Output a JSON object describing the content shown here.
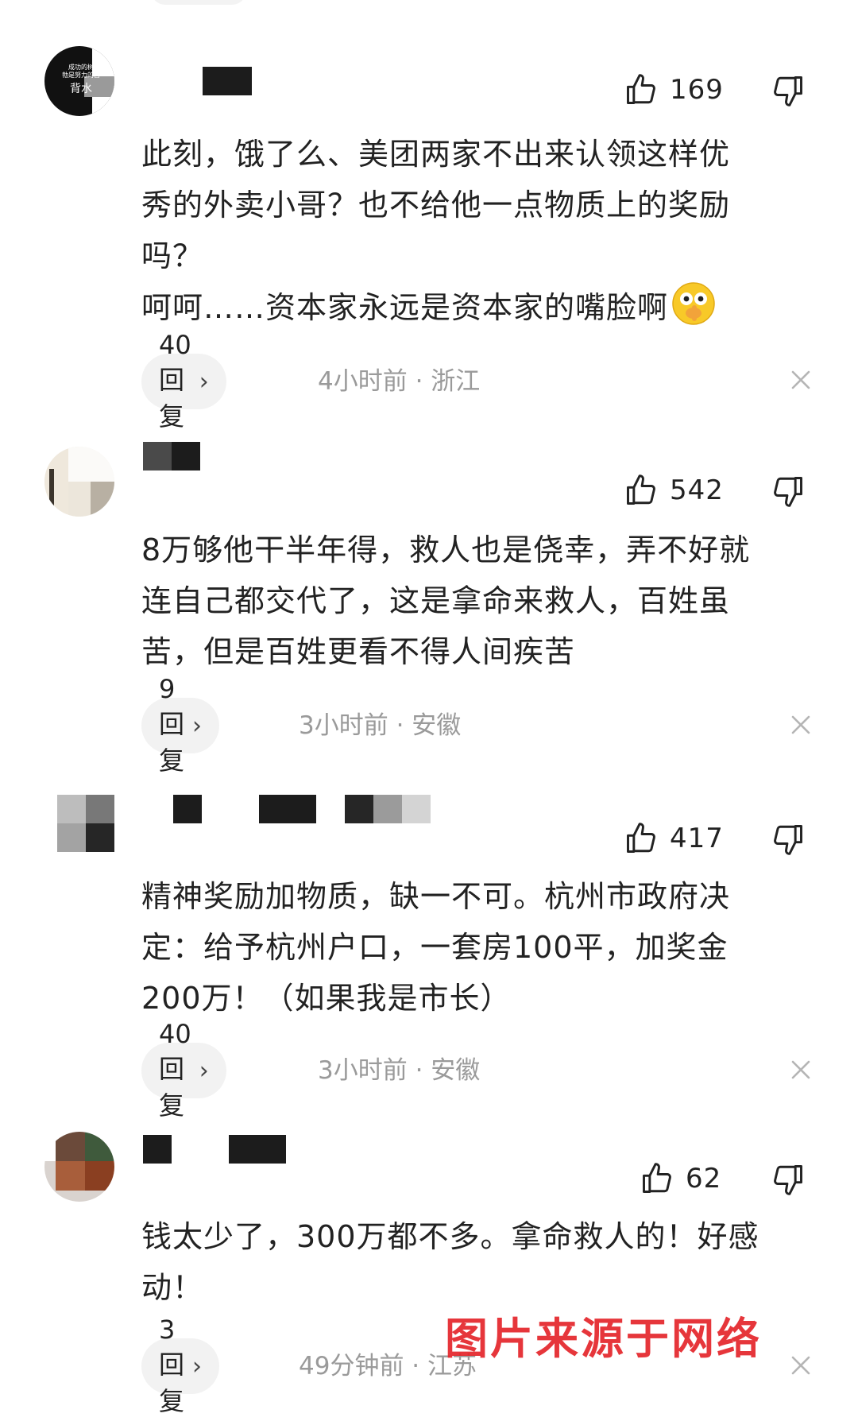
{
  "comments": [
    {
      "avatar_text": [
        "成功的树",
        "勃是努力的自",
        "背水"
      ],
      "likes": "169",
      "text": "此刻，饿了么、美团两家不出来认领这样优\n秀的外卖小哥？也不给他一点物质上的奖励\n吗？\n呵呵……资本家永远是资本家的嘴脸啊",
      "reply_label": "40回复",
      "meta": "4小时前 · 浙江",
      "emoji_icon": "hush-emoji-icon"
    },
    {
      "likes": "542",
      "text": "8万够他干半年得，救人也是侥幸，弄不好就\n连自己都交代了，这是拿命来救人，百姓虽\n苦，但是百姓更看不得人间疾苦",
      "reply_label": "9回复",
      "meta": "3小时前 · 安徽"
    },
    {
      "likes": "417",
      "text": "精神奖励加物质，缺一不可。杭州市政府决\n定：给予杭州户口，一套房100平，加奖金\n200万！（如果我是市长）",
      "reply_label": "40回复",
      "meta": "3小时前 · 安徽"
    },
    {
      "likes": "62",
      "text": "钱太少了，300万都不多。拿命救人的！好感\n动！",
      "reply_label": "3回复",
      "meta": "49分钟前 · 江苏"
    }
  ],
  "watermark": "图片来源于网络",
  "colors": {
    "watermark": "#e4262b",
    "meta_text": "#9a9a9a",
    "pill_bg": "#f2f2f2"
  }
}
